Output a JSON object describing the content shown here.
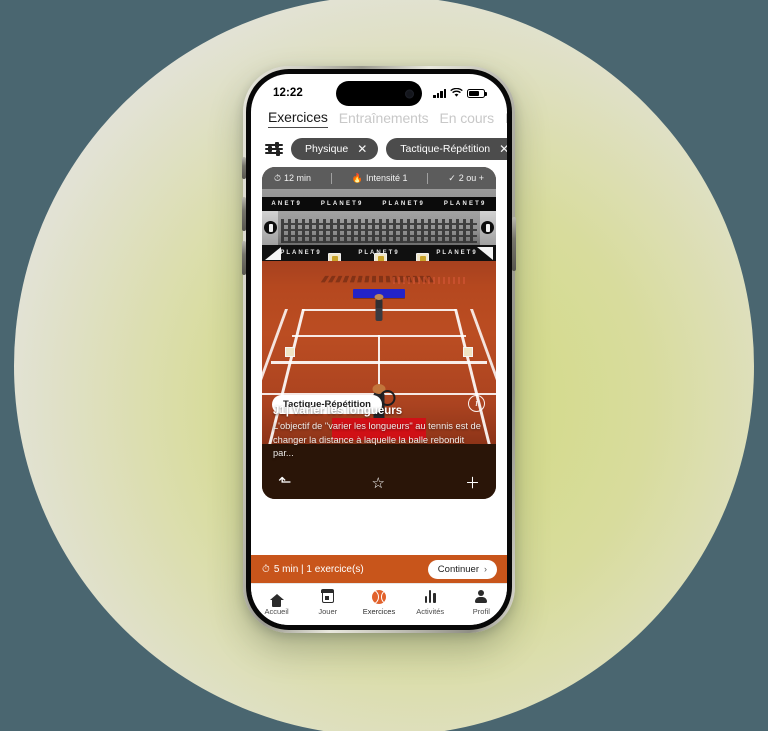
{
  "status_bar": {
    "time": "12:22",
    "signal_icon": "cellular-signal-icon",
    "wifi_icon": "wifi-icon",
    "battery_icon": "battery-icon"
  },
  "top_tabs": [
    {
      "label": "Exercices",
      "active": true
    },
    {
      "label": "Entraînements",
      "active": false
    },
    {
      "label": "En cours",
      "active": false
    },
    {
      "label": "M",
      "active": false
    }
  ],
  "filters": {
    "filter_icon": "filter-sliders-icon",
    "chips": [
      {
        "label": "Physique",
        "remove_icon": "close-icon",
        "remove_label": "✕"
      },
      {
        "label": "Tactique-Répétition",
        "remove_icon": "close-icon",
        "remove_label": "✕"
      }
    ]
  },
  "exercise_card": {
    "meta": [
      {
        "icon": "clock-icon",
        "glyph": "⏱",
        "label": "12 min"
      },
      {
        "icon": "flame-icon",
        "glyph": "🔥",
        "label": "Intensité 1"
      },
      {
        "icon": "check-icon",
        "glyph": "✓",
        "label": "2 ou +"
      }
    ],
    "sponsor_band_top": [
      "ANET9",
      "PLANET9",
      "PLANET9",
      "PLANET9"
    ],
    "sponsor_band_lower": [
      "PLANET9",
      "PLANET9",
      "PLANET9"
    ],
    "category_tag": "Tactique-Répétition",
    "info_icon": "info-icon",
    "info_glyph": "i",
    "title": "J1| Varier les longueurs",
    "description": "L'objectif de \"varier les longueurs\" au tennis est de changer la distance à laquelle la balle rebondit par...",
    "actions": [
      {
        "name": "undo-icon",
        "glyph": "⬏"
      },
      {
        "name": "star-icon",
        "glyph": "☆"
      },
      {
        "name": "plus-icon",
        "glyph": "＋"
      }
    ]
  },
  "session_bar": {
    "timer_icon": "stopwatch-icon",
    "timer_glyph": "⏱",
    "summary": "5 min  |  1 exercice(s)",
    "continue_label": "Continuer",
    "continue_chevron": "›",
    "accent_color": "#c8551b"
  },
  "tab_bar": [
    {
      "label": "Accueil",
      "icon": "home-icon",
      "active": false
    },
    {
      "label": "Jouer",
      "icon": "calendar-icon",
      "active": false
    },
    {
      "label": "Exercices",
      "icon": "tennis-ball-icon",
      "active": true
    },
    {
      "label": "Activités",
      "icon": "bar-chart-icon",
      "active": false
    },
    {
      "label": "Profil",
      "icon": "person-icon",
      "active": false
    }
  ],
  "theme": {
    "background_teal": "#4a6670",
    "blob_green": "#d3da8d",
    "clay_orange": "#b5481f",
    "accent_orange": "#c8551b"
  }
}
